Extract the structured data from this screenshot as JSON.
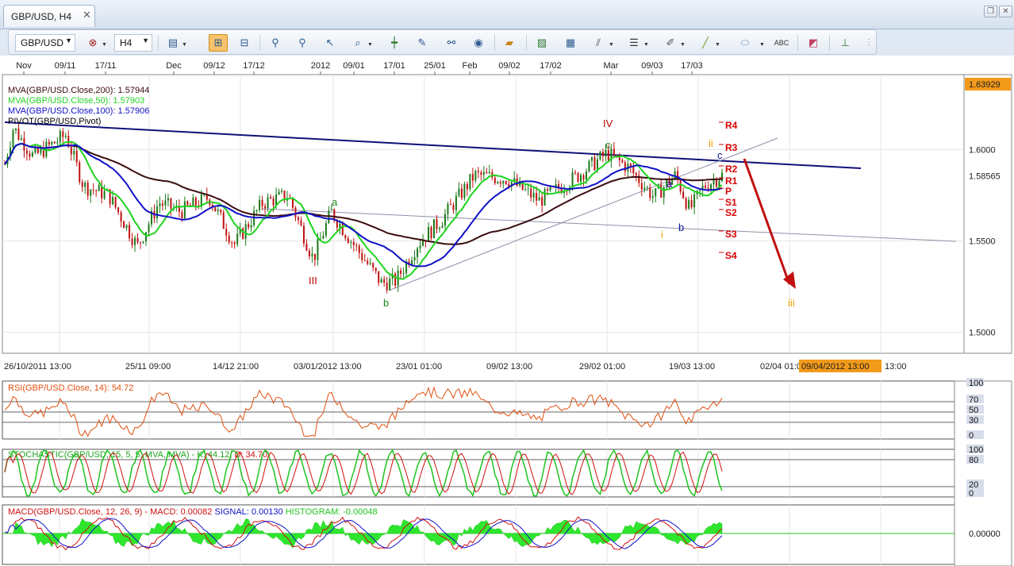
{
  "tab": {
    "title": "GBP/USD, H4",
    "close": "✕"
  },
  "window_controls": [
    "restore-icon",
    "close-icon"
  ],
  "toolbar": {
    "symbol": "GBP/USD",
    "timeframe": "H4",
    "buttons": [
      "chart-type-icon",
      "crosshair-off-icon",
      "timeframe-icon",
      "indicator-icon",
      "bar-chart-icon",
      "data-table-icon",
      "zoom-in-icon",
      "zoom-out-icon",
      "cursor-icon",
      "zoom-window-icon",
      "vertical-line-icon",
      "draw-icon",
      "magic-wand-icon",
      "globe-icon",
      "ruler-icon",
      "image-icon",
      "template-icon",
      "fibonacci-icon",
      "levels-icon",
      "pencil-icon",
      "line-icon",
      "ellipse-icon",
      "text-icon",
      "eraser-icon",
      "hierarchy-icon",
      "menu-icon"
    ]
  },
  "top_axis": [
    "Nov",
    "09/11",
    "17/11",
    "Dec",
    "09/12",
    "17/12",
    "2012",
    "09/01",
    "17/01",
    "25/01",
    "Feb",
    "09/02",
    "17/02",
    "Mar",
    "09/03",
    "17/03"
  ],
  "bottom_axis": [
    "26/10/2011 13:00",
    "25/11 09:00",
    "14/12 21:00",
    "03/01/2012 13:00",
    "23/01 01:00",
    "09/02 13:00",
    "29/02 01:00",
    "19/03 13:00",
    "02/04 01:00",
    "13:00"
  ],
  "cursor_time": "09/04/2012 13:00",
  "price_axis": {
    "ticks": [
      "1.6000",
      "1.5500",
      "1.5000"
    ],
    "last_price": "1.58565",
    "top_price": "1.63929",
    "range": [
      1.4885,
      1.641
    ]
  },
  "legend": [
    {
      "label": "MVA(GBP/USD.Close,200): 1.57944",
      "color": "#3c0c10"
    },
    {
      "label": "MVA(GBP/USD.Close,50): 1.57903",
      "color": "#1fd31f"
    },
    {
      "label": "MVA(GBP/USD.Close,100): 1.57906",
      "color": "#1010c8"
    },
    {
      "label": "PIVOT(GBP/USD,Pivot)",
      "color": "#000000"
    }
  ],
  "waves": [
    {
      "label": "IV",
      "color": "#c00000"
    },
    {
      "label": "III",
      "color": "#c00000"
    },
    {
      "label": "a",
      "color": "#1a8c1a"
    },
    {
      "label": "b",
      "color": "#1a8c1a"
    },
    {
      "label": "c",
      "color": "#1a8c1a"
    },
    {
      "label": "ii",
      "color": "#f0a000"
    },
    {
      "label": "c",
      "color": "#1010a0"
    },
    {
      "label": "a",
      "color": "#1010a0"
    },
    {
      "label": "b",
      "color": "#1010a0"
    },
    {
      "label": "i",
      "color": "#f0a000"
    },
    {
      "label": "iii",
      "color": "#f0a000"
    }
  ],
  "pivots": [
    "R4",
    "R3",
    "R2",
    "R1",
    "P",
    "S1",
    "S2",
    "S3",
    "S4"
  ],
  "rsi": {
    "label": "RSI(GBP/USD.Close, 14): 54.72",
    "levels": [
      "100",
      "70",
      "50",
      "30",
      "0"
    ],
    "color": "#e05010"
  },
  "stochastic": {
    "label_main": "STOCHASTIC(GBP/USD, 15, 5, 5, MVA, MVA) - ",
    "k_label": "K: 44.12",
    "d_label": "D: 34.70",
    "levels": [
      "100",
      "80",
      "20",
      "0"
    ]
  },
  "macd": {
    "prefix": "MACD(GBP/USD.Close, 12, 26, 9) - ",
    "macd_label": "MACD: 0.00082",
    "signal_label": "SIGNAL: 0.00130",
    "hist_label": "HISTOGRAM: -0.00048",
    "level": "0.00000"
  },
  "chart_data": {
    "type": "line",
    "instrument": "GBP/USD",
    "timeframe": "H4",
    "x": [
      "Nov",
      "Dec",
      "2012",
      "Feb",
      "Mar"
    ],
    "series": [
      {
        "name": "MVA(GBP/USD.Close,200)",
        "last": 1.57944
      },
      {
        "name": "MVA(GBP/USD.Close,50)",
        "last": 1.57903
      },
      {
        "name": "MVA(GBP/USD.Close,100)",
        "last": 1.57906
      }
    ],
    "ylim": [
      1.4885,
      1.641
    ],
    "last_price": 1.58565
  }
}
